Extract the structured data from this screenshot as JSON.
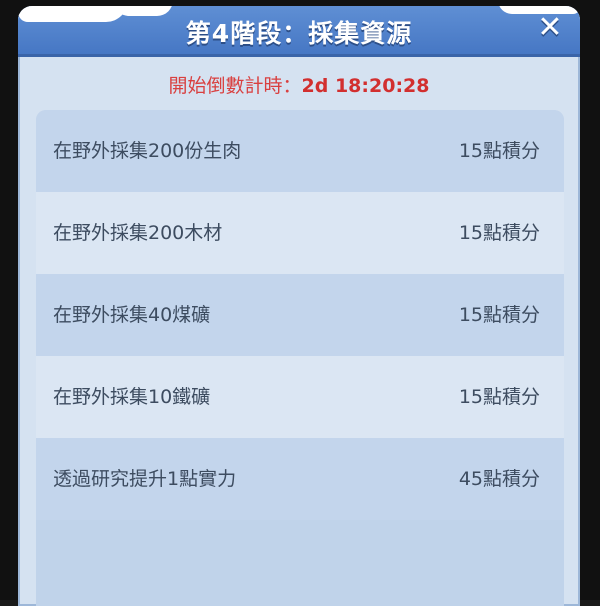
{
  "header": {
    "title": "第4階段：採集資源",
    "close_icon": "close-icon"
  },
  "countdown": {
    "label": "開始倒數計時：",
    "time": "2d 18:20:28"
  },
  "tasks": [
    {
      "label": "在野外採集200份生肉",
      "points": "15點積分"
    },
    {
      "label": "在野外採集200木材",
      "points": "15點積分"
    },
    {
      "label": "在野外採集40煤礦",
      "points": "15點積分"
    },
    {
      "label": "在野外採集10鐵礦",
      "points": "15點積分"
    },
    {
      "label": "透過研究提升1點實力",
      "points": "45點積分"
    }
  ],
  "colors": {
    "header": "#4f80cc",
    "countdown": "#d22f2f",
    "text": "#3d4c60"
  }
}
